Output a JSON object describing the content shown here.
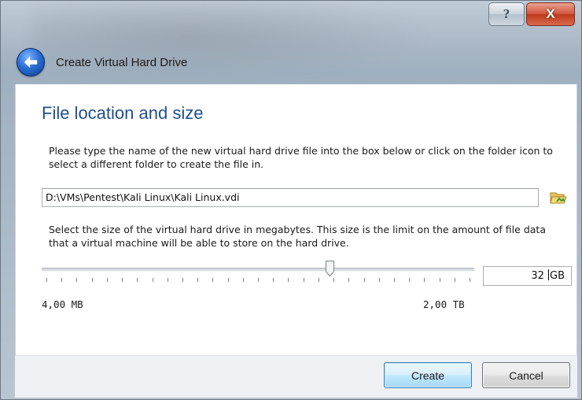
{
  "window": {
    "help_label": "?",
    "close_label": "X"
  },
  "header": {
    "title": "Create Virtual Hard Drive",
    "back_icon": "back-arrow-icon"
  },
  "page": {
    "title": "File location and size",
    "location_description": "Please type the name of the new virtual hard drive file into the box below or click on the folder icon to select a different folder to create the file in.",
    "file_path": "D:\\VMs\\Pentest\\Kali Linux\\Kali Linux.vdi",
    "folder_icon": "folder-icon",
    "size_description": "Select the size of the virtual hard drive in megabytes. This size is the limit on the amount of file data that a virtual machine will be able to store on the hard drive.",
    "size_value": "32 GB",
    "slider_fraction": 0.67,
    "range_min": "4,00 MB",
    "range_max": "2,00 TB"
  },
  "footer": {
    "create_label": "Create",
    "cancel_label": "Cancel"
  },
  "colors": {
    "title_blue": "#1f4e8c",
    "close_red": "#c03a1c",
    "primary_button_border": "#3c7fb1"
  }
}
